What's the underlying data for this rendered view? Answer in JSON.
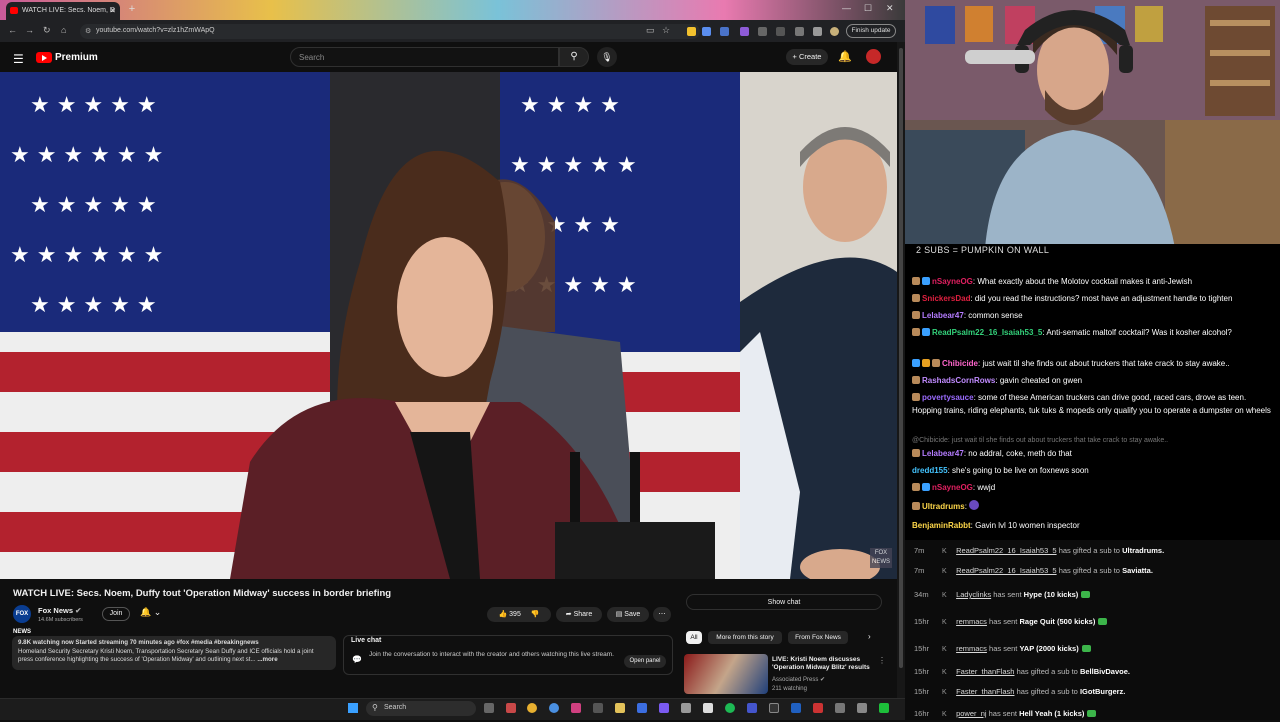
{
  "browser": {
    "tab_title": "WATCH LIVE: Secs. Noem, D",
    "url": "youtube.com/watch?v=zlz1hZmWApQ",
    "finish_update": "Finish update"
  },
  "youtube": {
    "brand": "Premium",
    "search_placeholder": "Search",
    "create_label": "Create",
    "video_title": "WATCH LIVE: Secs. Noem, Duffy tout 'Operation Midway' success in border briefing",
    "channel_name": "Fox News",
    "channel_logo_text": "FOX NEWS",
    "subscribers": "14.6M subscribers",
    "join_label": "Join",
    "likes": "395",
    "share_label": "Share",
    "save_label": "Save",
    "description_line1": "9.8K watching now  Started streaming 70 minutes ago  #fox #media #breakingnews",
    "description_line2": "Homeland Security Secretary Kristi Noem, Transportation Secretary Sean Duffy and ICE officials hold a joint press conference highlighting the success of 'Operation Midway' and outlining next st...",
    "more_label": "...more",
    "live_chat_label": "Live chat",
    "live_chat_text": "Join the conversation to interact with the creator and others watching this live stream.",
    "open_panel_label": "Open panel",
    "show_chat_label": "Show chat",
    "chips": [
      "All",
      "More from this story",
      "From Fox News"
    ],
    "related": {
      "title": "LIVE: Kristi Noem discusses 'Operation Midway Blitz' results",
      "channel": "Associated Press",
      "watching": "211 watching"
    },
    "video_bug": "FOX NEWS"
  },
  "taskbar": {
    "search_label": "Search"
  },
  "stream": {
    "overlay_text": "2 SUBS = PUMPKIN ON WALL",
    "chat": [
      {
        "user": "nSayneOG",
        "color": "#e02060",
        "text": "What exactly about the Molotov cocktail makes it anti-Jewish"
      },
      {
        "user": "SnickersDad",
        "color": "#e02040",
        "text": "did you read the instructions? most have an adjustment handle to tighten"
      },
      {
        "user": "Lelabear47",
        "color": "#b47cff",
        "text": "common sense"
      },
      {
        "user": "ReadPsalm22_16_Isaiah53_5",
        "color": "#33d17a",
        "text": "Anti-sematic maltolf cocktail? Was it kosher alcohol?"
      },
      {
        "user": "Chibicide",
        "color": "#ff66cc",
        "text": "just wait til she finds out about truckers that take crack to stay awake.."
      },
      {
        "user": "RashadsCornRows",
        "color": "#c08bff",
        "text": "gavin cheated on gwen"
      },
      {
        "user": "povertysauce",
        "color": "#9b6bff",
        "text": "some of these American truckers can drive good, raced cars, drove as teen. Hopping trains, riding elephants, tuk tuks & mopeds only qualify you to operate a dumpster on wheels"
      },
      {
        "reply": "@Chibicide: just wait til she finds out about truckers that take crack to stay awake.."
      },
      {
        "user": "Lelabear47",
        "color": "#b47cff",
        "text": "no addral, coke, meth do that"
      },
      {
        "user": "dredd155",
        "color": "#44c4ff",
        "text": "she's going to be live on foxnews soon"
      },
      {
        "user": "nSayneOG",
        "color": "#e02060",
        "text": "wwjd"
      },
      {
        "user": "Ultradrums",
        "color": "#ffd84a",
        "text": ""
      },
      {
        "user": "BenjaminRabbt",
        "color": "#ffd84a",
        "text": "Gavin lvl 10 women inspector"
      }
    ],
    "events": [
      {
        "time": "7m",
        "user": "ReadPsalm22_16_Isaiah53_5",
        "action": "has gifted a sub to",
        "target": "Ultradrums."
      },
      {
        "time": "7m",
        "user": "ReadPsalm22_16_Isaiah53_5",
        "action": "has gifted a sub to",
        "target": "Saviatta."
      },
      {
        "time": "34m",
        "user": "Ladyclinks",
        "action": "has sent",
        "target": "Hype (10 kicks)"
      },
      {
        "time": "15hr",
        "user": "remmacs",
        "action": "has sent",
        "target": "Rage Quit (500 kicks)"
      },
      {
        "time": "15hr",
        "user": "remmacs",
        "action": "has sent",
        "target": "YAP (2000 kicks)"
      },
      {
        "time": "15hr",
        "user": "Faster_thanFlash",
        "action": "has gifted a sub to",
        "target": "BellBivDavoe."
      },
      {
        "time": "15hr",
        "user": "Faster_thanFlash",
        "action": "has gifted a sub to",
        "target": "IGotBurgerz."
      },
      {
        "time": "16hr",
        "user": "power_nj",
        "action": "has sent",
        "target": "Hell Yeah (1 kicks)"
      }
    ]
  }
}
